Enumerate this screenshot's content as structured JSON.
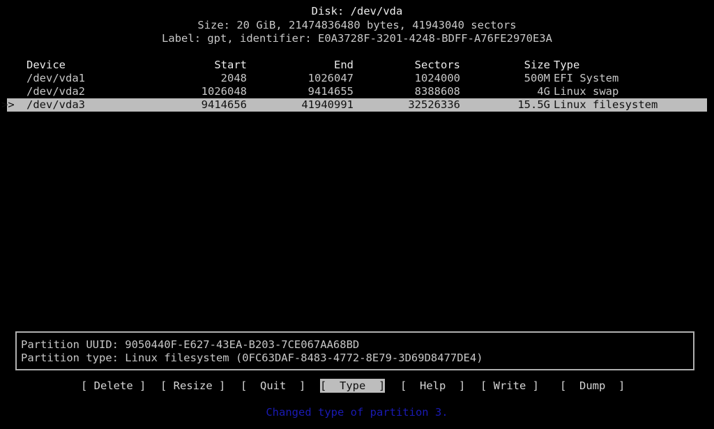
{
  "header": {
    "title": "Disk: /dev/vda",
    "size_line": "Size: 20 GiB, 21474836480 bytes, 41943040 sectors",
    "label_line": "Label: gpt, identifier: E0A3728F-3201-4248-BDFF-A76FE2970E3A"
  },
  "table": {
    "columns": [
      "Device",
      "Start",
      "End",
      "Sectors",
      "Size",
      "Type"
    ],
    "rows": [
      {
        "marker": "",
        "device": "/dev/vda1",
        "start": "2048",
        "end": "1026047",
        "sectors": "1024000",
        "size": "500M",
        "type": "EFI System",
        "selected": false
      },
      {
        "marker": "",
        "device": "/dev/vda2",
        "start": "1026048",
        "end": "9414655",
        "sectors": "8388608",
        "size": "4G",
        "type": "Linux swap",
        "selected": false
      },
      {
        "marker": ">>",
        "device": "/dev/vda3",
        "start": "9414656",
        "end": "41940991",
        "sectors": "32526336",
        "size": "15.5G",
        "type": "Linux filesystem",
        "selected": true
      }
    ]
  },
  "info": {
    "uuid_line": "Partition UUID: 9050440F-E627-43EA-B203-7CE067AA68BD",
    "type_line": "Partition type: Linux filesystem (0FC63DAF-8483-4772-8E79-3D69D8477DE4)"
  },
  "menu": {
    "buttons": [
      {
        "label": "[ Delete ]",
        "active": false
      },
      {
        "label": "[ Resize ]",
        "active": false
      },
      {
        "label": "[  Quit  ]",
        "active": false
      },
      {
        "label": "[  Type  ]",
        "active": true
      },
      {
        "label": "[  Help  ]",
        "active": false
      },
      {
        "label": "[ Write ]",
        "active": false
      },
      {
        "label": "[  Dump  ]",
        "active": false
      }
    ]
  },
  "status": {
    "message": "Changed type of partition 3.",
    "color": "#1a1ab4"
  }
}
